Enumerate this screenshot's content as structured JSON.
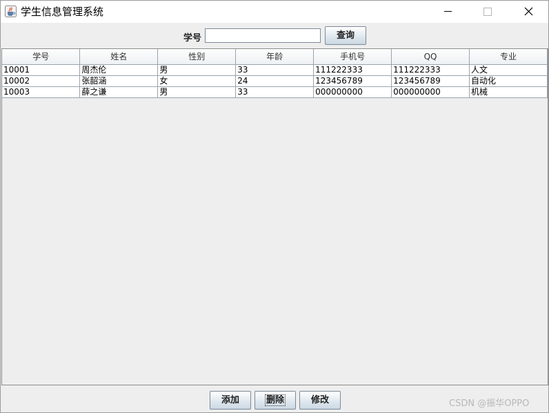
{
  "window": {
    "title": "学生信息管理系统"
  },
  "search": {
    "label": "学号",
    "value": "",
    "button_label": "查询"
  },
  "table": {
    "columns": [
      "学号",
      "姓名",
      "性别",
      "年龄",
      "手机号",
      "QQ",
      "专业"
    ],
    "rows": [
      [
        "10001",
        "周杰伦",
        "男",
        "33",
        "111222333",
        "111222333",
        "人文"
      ],
      [
        "10002",
        "张韶涵",
        "女",
        "24",
        "123456789",
        "123456789",
        "自动化"
      ],
      [
        "10003",
        "薛之谦",
        "男",
        "33",
        "000000000",
        "000000000",
        "机械"
      ]
    ]
  },
  "actions": {
    "add_label": "添加",
    "delete_label": "删除",
    "edit_label": "修改"
  },
  "watermark": "CSDN @振华OPPO",
  "icons": {
    "app": "java-cup-icon",
    "minimize": "minimize-icon",
    "maximize": "maximize-icon",
    "close": "close-icon"
  }
}
